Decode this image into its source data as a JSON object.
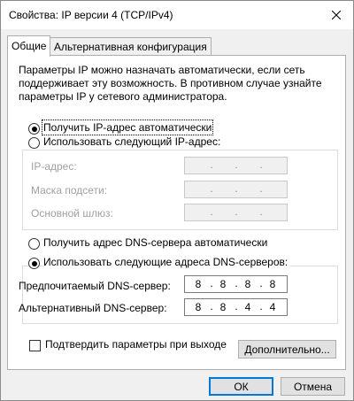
{
  "window": {
    "title": "Свойства: IP версии 4 (TCP/IPv4)",
    "close_icon": "close-icon"
  },
  "tabs": [
    {
      "label": "Общие",
      "active": true
    },
    {
      "label": "Альтернативная конфигурация",
      "active": false
    }
  ],
  "general": {
    "description_lines": [
      "Параметры IP можно назначать автоматически, если сеть",
      "поддерживает эту возможность. В противном случае узнайте",
      "параметры IP у сетевого администратора."
    ],
    "ip": {
      "auto_label": "Получить IP-адрес автоматически",
      "auto_selected": true,
      "manual_label": "Использовать следующий IP-адрес:",
      "manual_selected": false,
      "fields": [
        {
          "label": "IP-адрес:",
          "value": ""
        },
        {
          "label": "Маска подсети:",
          "value": ""
        },
        {
          "label": "Основной шлюз:",
          "value": ""
        }
      ]
    },
    "dns": {
      "auto_label": "Получить адрес DNS-сервера автоматически",
      "auto_selected": false,
      "manual_label": "Использовать следующие адреса DNS-серверов:",
      "manual_selected": true,
      "preferred": {
        "label": "Предпочитаемый DNS-сервер:",
        "octets": [
          "8",
          "8",
          "8",
          "8"
        ]
      },
      "alternate": {
        "label": "Альтернативный DNS-сервер:",
        "octets": [
          "8",
          "8",
          "4",
          "4"
        ]
      }
    },
    "validate_label": "Подтвердить параметры при выходе",
    "validate_checked": false,
    "advanced_label": "Дополнительно..."
  },
  "buttons": {
    "ok": "ОК",
    "cancel": "Отмена"
  }
}
